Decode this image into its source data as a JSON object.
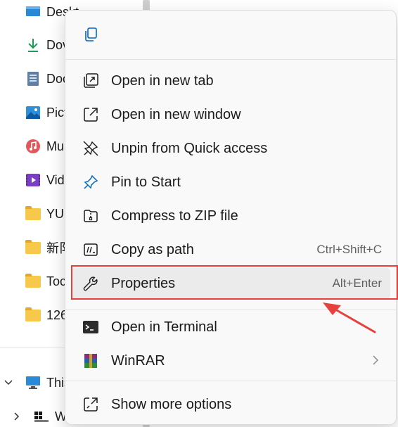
{
  "nav": {
    "items": [
      {
        "label": "Deskt",
        "icon": "desktop-icon"
      },
      {
        "label": "Dov",
        "icon": "download-icon"
      },
      {
        "label": "Doc",
        "icon": "documents-icon"
      },
      {
        "label": "Pict",
        "icon": "pictures-icon"
      },
      {
        "label": "Mu",
        "icon": "music-icon"
      },
      {
        "label": "Vid",
        "icon": "videos-icon"
      },
      {
        "label": "YUI",
        "icon": "folder-icon"
      },
      {
        "label": "新阝",
        "icon": "folder-icon"
      },
      {
        "label": "Toc",
        "icon": "folder-icon"
      },
      {
        "label": "126",
        "icon": "folder-icon"
      }
    ],
    "this_pc": "This",
    "windows": "W"
  },
  "menu": {
    "copy_icon": "copy-icon",
    "items": [
      {
        "label": "Open in new tab",
        "shortcut": "",
        "icon": "open-new-tab-icon"
      },
      {
        "label": "Open in new window",
        "shortcut": "",
        "icon": "open-new-window-icon"
      },
      {
        "label": "Unpin from Quick access",
        "shortcut": "",
        "icon": "unpin-icon"
      },
      {
        "label": "Pin to Start",
        "shortcut": "",
        "icon": "pin-icon"
      },
      {
        "label": "Compress to ZIP file",
        "shortcut": "",
        "icon": "zip-icon"
      },
      {
        "label": "Copy as path",
        "shortcut": "Ctrl+Shift+C",
        "icon": "copy-path-icon"
      },
      {
        "label": "Properties",
        "shortcut": "Alt+Enter",
        "icon": "wrench-icon"
      },
      {
        "label": "Open in Terminal",
        "shortcut": "",
        "icon": "terminal-icon"
      },
      {
        "label": "WinRAR",
        "shortcut": "",
        "icon": "winrar-icon",
        "submenu": true
      },
      {
        "label": "Show more options",
        "shortcut": "",
        "icon": "more-options-icon"
      }
    ]
  },
  "colors": {
    "highlight": "#e8413d",
    "menu_bg": "#f9f9f9",
    "hover_bg": "#ebebeb",
    "icon_stroke": "#1b1b1b",
    "accent_blue": "#0067c0"
  }
}
